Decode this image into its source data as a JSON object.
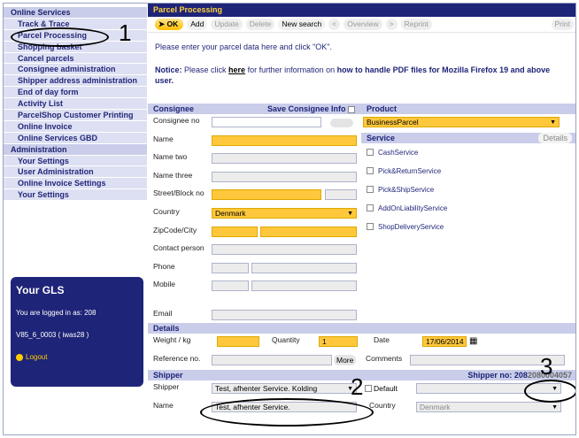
{
  "sidebar": {
    "items": [
      {
        "label": "Online Services",
        "type": "head"
      },
      {
        "label": "Track & Trace",
        "type": "sub"
      },
      {
        "label": "Parcel Processing",
        "type": "sub"
      },
      {
        "label": "Shopping basket",
        "type": "sub"
      },
      {
        "label": "Cancel parcels",
        "type": "sub"
      },
      {
        "label": "Consignee administration",
        "type": "sub"
      },
      {
        "label": "Shipper address administration",
        "type": "sub"
      },
      {
        "label": "End of day form",
        "type": "sub"
      },
      {
        "label": "Activity List",
        "type": "sub"
      },
      {
        "label": "ParcelShop Customer Printing",
        "type": "sub"
      },
      {
        "label": "Online Invoice",
        "type": "sub"
      },
      {
        "label": "Online Services GBD",
        "type": "sub"
      },
      {
        "label": "Administration",
        "type": "head"
      },
      {
        "label": "Your Settings",
        "type": "sub"
      },
      {
        "label": "User Administration",
        "type": "sub"
      },
      {
        "label": "Online Invoice Settings",
        "type": "sub"
      },
      {
        "label": "Your Settings",
        "type": "sub"
      }
    ],
    "gls": {
      "title": "Your GLS",
      "logged_in": "You are logged in as: 208",
      "version": "V85_6_0003 ( iwas28 )",
      "logout": "Logout"
    }
  },
  "annotations": {
    "one": "1",
    "two": "2",
    "three": "3"
  },
  "main": {
    "title": "Parcel Processing",
    "toolbar": {
      "ok": "OK",
      "add": "Add",
      "update": "Update",
      "delete": "Delete",
      "new_search": "New search",
      "back": "<",
      "overview": "Overview",
      "forward": ">",
      "reprint": "Reprint",
      "print": "Print"
    },
    "prompt": "Please enter your parcel data here and click \"OK\".",
    "notice": {
      "prefix": "Notice:",
      "text1": " Please click ",
      "link": "here",
      "text2": " for further information on ",
      "bold": "how to handle PDF files for Mozilla Firefox 19 and above user."
    }
  },
  "consignee": {
    "header": "Consignee",
    "save_label": "Save Consignee Info",
    "fields": {
      "consignee_no": "Consignee no",
      "name": "Name",
      "name_two": "Name two",
      "name_three": "Name three",
      "street": "Street/Block no",
      "country": "Country",
      "country_value": "Denmark",
      "zip": "ZipCode/City",
      "contact": "Contact person",
      "phone": "Phone",
      "mobile": "Mobile",
      "email": "Email"
    }
  },
  "product": {
    "header": "Product",
    "value": "BusinessParcel",
    "service_header": "Service",
    "details": "Details",
    "services": [
      "CashService",
      "Pick&ReturnService",
      "Pick&ShipService",
      "AddOnLiabilityService",
      "ShopDeliveryService"
    ]
  },
  "details": {
    "header": "Details",
    "weight": "Weight / kg",
    "quantity": "Quantity",
    "quantity_value": "1",
    "date": "Date",
    "date_value": "17/06/2014",
    "reference": "Reference no.",
    "more": "More",
    "comments": "Comments"
  },
  "shipper": {
    "header": "Shipper",
    "shipper_no_label": "Shipper no: 208",
    "shipper_no_value": "2080004057",
    "shipper_label": "Shipper",
    "shipper_value": "Test, afhenter Service. Kolding",
    "default_label": "Default",
    "name_label": "Name",
    "name_value": "Test, afhenter Service.",
    "country_label": "Country",
    "country_value": "Denmark"
  },
  "colors": {
    "navy": "#1e2477",
    "yellow_field": "#ffc83c",
    "menu_bg": "#d4d8ef"
  }
}
